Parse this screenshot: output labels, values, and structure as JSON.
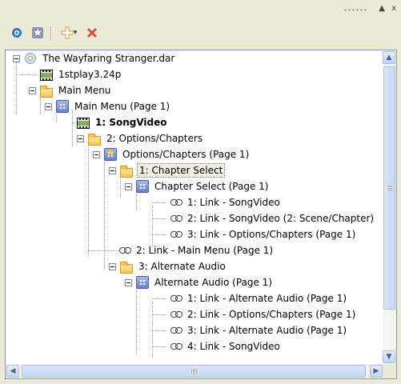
{
  "titlebar": {
    "pin_label": "▲",
    "close_label": "x"
  },
  "toolbar": {
    "add_arrow": "▾"
  },
  "tree": {
    "rows": [
      "The Wayfaring Stranger.dar",
      "1stplay3.24p",
      "Main Menu",
      "Main Menu (Page 1)",
      "1: SongVideo",
      "2: Options/Chapters",
      "Options/Chapters (Page 1)",
      "1: Chapter Select",
      "Chapter Select (Page 1)",
      "1: Link - SongVideo",
      "2: Link - SongVideo (2: Scene/Chapter)",
      "3: Link - Options/Chapters (Page 1)",
      "2: Link - Main Menu (Page 1)",
      "3: Alternate Audio",
      "Alternate Audio (Page 1)",
      "1: Link - Alternate Audio (Page 1)",
      "2: Link - Options/Chapters (Page 1)",
      "3: Link - Alternate Audio (Page 1)",
      "4: Link - SongVideo"
    ]
  },
  "scroll": {
    "up": "▲",
    "down": "▼",
    "left": "◀",
    "right": "▶"
  }
}
